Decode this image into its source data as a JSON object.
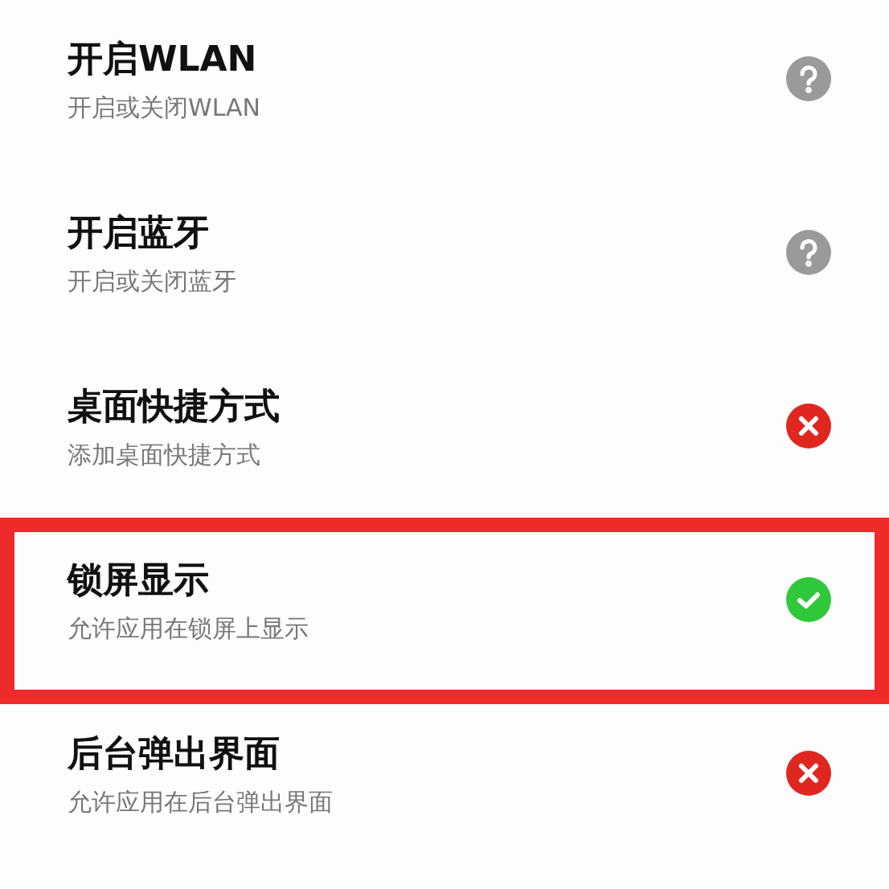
{
  "permissions": [
    {
      "title": "开启WLAN",
      "subtitle": "开启或关闭WLAN",
      "kind": "unknown",
      "highlighted": false
    },
    {
      "title": "开启蓝牙",
      "subtitle": "开启或关闭蓝牙",
      "kind": "unknown",
      "highlighted": false
    },
    {
      "title": "桌面快捷方式",
      "subtitle": "添加桌面快捷方式",
      "kind": "denied",
      "highlighted": false
    },
    {
      "title": "锁屏显示",
      "subtitle": "允许应用在锁屏上显示",
      "kind": "allowed",
      "highlighted": true
    },
    {
      "title": "后台弹出界面",
      "subtitle": "允许应用在后台弹出界面",
      "kind": "denied",
      "highlighted": false
    }
  ]
}
